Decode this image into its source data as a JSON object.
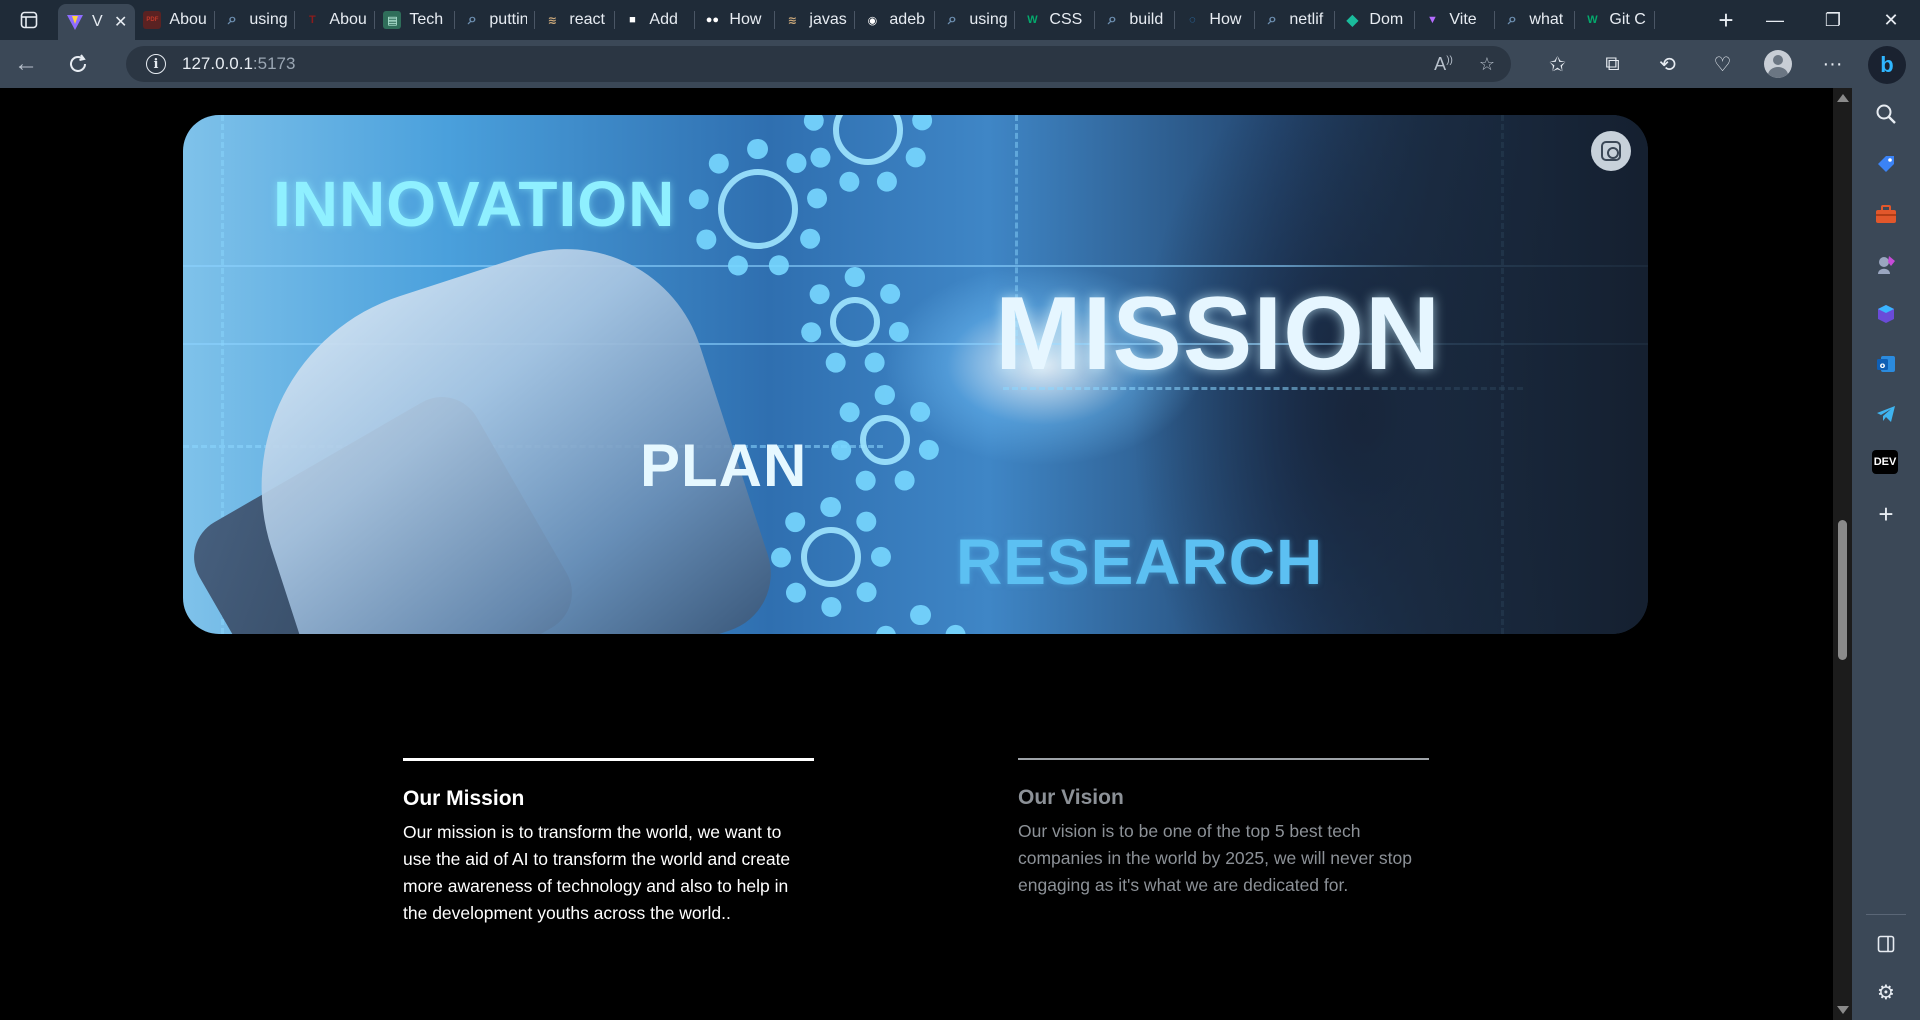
{
  "browser": {
    "active_tab": {
      "title": "V",
      "favicon": "vite-icon"
    },
    "tabs": [
      {
        "title": "Abou",
        "favicon": "pdf-icon",
        "color": "#c0392b"
      },
      {
        "title": "using",
        "favicon": "search-icon",
        "color": "#6d8fb0"
      },
      {
        "title": "Abou",
        "favicon": "red-logo-icon",
        "color": "#8b1c1c"
      },
      {
        "title": "Tech",
        "favicon": "document-icon",
        "color": "#3c8c73"
      },
      {
        "title": "puttin",
        "favicon": "search-icon",
        "color": "#6d8fb0"
      },
      {
        "title": "react",
        "favicon": "stack-icon",
        "color": "#c9a77a"
      },
      {
        "title": "Add",
        "favicon": "video-icon",
        "color": "#ffffff"
      },
      {
        "title": "How",
        "favicon": "medium-icon",
        "color": "#ffffff"
      },
      {
        "title": "javas",
        "favicon": "stack-icon",
        "color": "#c9a77a"
      },
      {
        "title": "adeb",
        "favicon": "github-icon",
        "color": "#ffffff"
      },
      {
        "title": "using",
        "favicon": "search-icon",
        "color": "#6d8fb0"
      },
      {
        "title": "CSS",
        "favicon": "w3-icon",
        "color": "#04aa6d"
      },
      {
        "title": "build",
        "favicon": "search-icon",
        "color": "#6d8fb0"
      },
      {
        "title": "How",
        "favicon": "swirl-icon",
        "color": "#2f8dde"
      },
      {
        "title": "netlif",
        "favicon": "search-icon",
        "color": "#6d8fb0"
      },
      {
        "title": "Dom",
        "favicon": "diamond-icon",
        "color": "#1abc9c"
      },
      {
        "title": "Vite",
        "favicon": "vite-icon",
        "color": "#b56cff"
      },
      {
        "title": "what",
        "favicon": "search-icon",
        "color": "#6d8fb0"
      },
      {
        "title": "Git C",
        "favicon": "w3-icon",
        "color": "#04aa6d"
      }
    ],
    "url_host": "127.0.0.1",
    "url_port": ":5173",
    "sidebar_icons": [
      "search-icon",
      "tag-icon",
      "toolbox-icon",
      "games-icon",
      "copilot-icon",
      "outlook-icon",
      "telegram-icon",
      "dev-icon",
      "add-icon"
    ],
    "dev_label": "DEV"
  },
  "hero": {
    "words": {
      "innovation": "INNOVATION",
      "mission": "MISSION",
      "plan": "PLAN",
      "research": "RESEARCH"
    }
  },
  "mission": {
    "heading": "Our Mission",
    "body": "Our mission is to transform the world, we want to use the aid of AI to transform the world and create more awareness of technology and also to help in the development youths across the world.."
  },
  "vision": {
    "heading": "Our Vision",
    "body": "Our vision is to be one of the top 5 best tech companies in the world by 2025, we will never stop engaging as it's what we are dedicated for."
  }
}
